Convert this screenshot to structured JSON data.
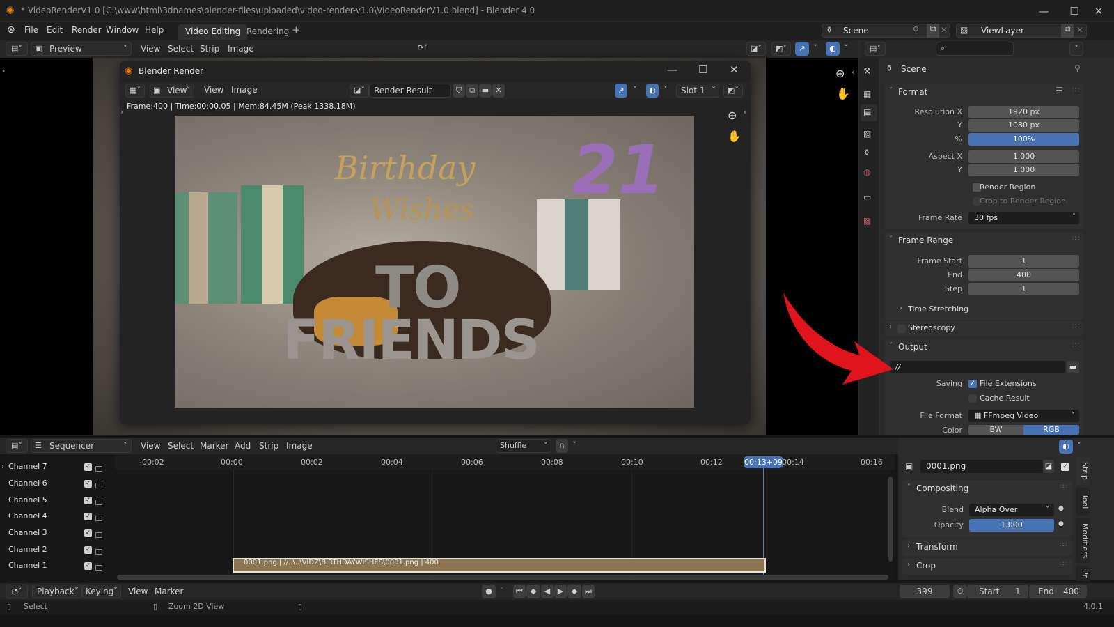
{
  "window": {
    "title": "* VideoRenderV1.0 [C:\\www\\html\\3dnames\\blender-files\\uploaded\\video-render-v1.0\\VideoRenderV1.0.blend] - Blender 4.0",
    "controls": {
      "minimize": "—",
      "maximize": "☐",
      "close": "✕"
    }
  },
  "menubar": {
    "items": [
      "File",
      "Edit",
      "Render",
      "Window",
      "Help"
    ],
    "workspaces": [
      {
        "label": "Video Editing",
        "active": true
      },
      {
        "label": "Rendering",
        "active": false
      }
    ],
    "add_workspace": "+",
    "scene": "Scene",
    "view_layer": "ViewLayer"
  },
  "preview_header": {
    "mode": "Preview",
    "menus": [
      "View",
      "Select",
      "Strip",
      "Image"
    ]
  },
  "render_window": {
    "title": "Blender Render",
    "view_dropdown": "View",
    "menus": [
      "View",
      "Image"
    ],
    "image_name": "Render Result",
    "slot": "Slot 1",
    "stats": "Frame:400 | Time:00:00.05 | Mem:84.45M (Peak 1338.18M)",
    "image_text": {
      "line1": "Birthday",
      "line2": "Wishes",
      "number": "21",
      "line3": "TO",
      "line4": "FRIENDS"
    }
  },
  "properties": {
    "search_placeholder": "",
    "context": "Scene",
    "format": {
      "title": "Format",
      "resolution_x_label": "Resolution X",
      "resolution_x": "1920 px",
      "resolution_y_label": "Y",
      "resolution_y": "1080 px",
      "percent_label": "%",
      "percent": "100%",
      "aspect_x_label": "Aspect X",
      "aspect_x": "1.000",
      "aspect_y_label": "Y",
      "aspect_y": "1.000",
      "render_region": "Render Region",
      "crop_region": "Crop to Render Region",
      "frame_rate_label": "Frame Rate",
      "frame_rate": "30 fps"
    },
    "frame_range": {
      "title": "Frame Range",
      "start_label": "Frame Start",
      "start": "1",
      "end_label": "End",
      "end": "400",
      "step_label": "Step",
      "step": "1",
      "time_stretching": "Time Stretching"
    },
    "stereoscopy": "Stereoscopy",
    "output": {
      "title": "Output",
      "path": "//",
      "saving_label": "Saving",
      "file_extensions": "File Extensions",
      "file_extensions_checked": true,
      "cache_result": "Cache Result",
      "cache_result_checked": false,
      "file_format_label": "File Format",
      "file_format": "FFmpeg Video",
      "color_label": "Color",
      "color_options": [
        "BW",
        "RGB"
      ],
      "color_selected": "RGB"
    }
  },
  "sequencer": {
    "editor": "Sequencer",
    "menus": [
      "View",
      "Select",
      "Marker",
      "Add",
      "Strip",
      "Image"
    ],
    "overlap_mode": "Shuffle",
    "ruler_ticks": [
      "-00:02",
      "00:00",
      "00:02",
      "00:04",
      "00:06",
      "00:08",
      "00:10",
      "00:12",
      "00:14",
      "00:16"
    ],
    "playhead": "00:13+09",
    "channels": [
      "Channel 7",
      "Channel 6",
      "Channel 5",
      "Channel 4",
      "Channel 3",
      "Channel 2",
      "Channel 1"
    ],
    "strip_label": "0001.png | //..\\..\\VIDZ\\BIRTHDAYWISHES\\0001.png | 400"
  },
  "strip_sidebar": {
    "strip_name": "0001.png",
    "compositing": "Compositing",
    "blend_label": "Blend",
    "blend": "Alpha Over",
    "opacity_label": "Opacity",
    "opacity": "1.000",
    "transform": "Transform",
    "crop": "Crop",
    "tabs": [
      "Strip",
      "Tool",
      "Modifiers",
      "Pr"
    ]
  },
  "timeline": {
    "menus": [
      "Playback",
      "Keying",
      "View",
      "Marker"
    ],
    "current_frame": "399",
    "start_label": "Start",
    "start": "1",
    "end_label": "End",
    "end": "400"
  },
  "statusbar": {
    "select": "Select",
    "zoom": "Zoom 2D View",
    "version": "4.0.1"
  },
  "colors": {
    "accent": "#4772b3",
    "strip": "#8c7550",
    "annotation_arrow": "#e0141c"
  }
}
